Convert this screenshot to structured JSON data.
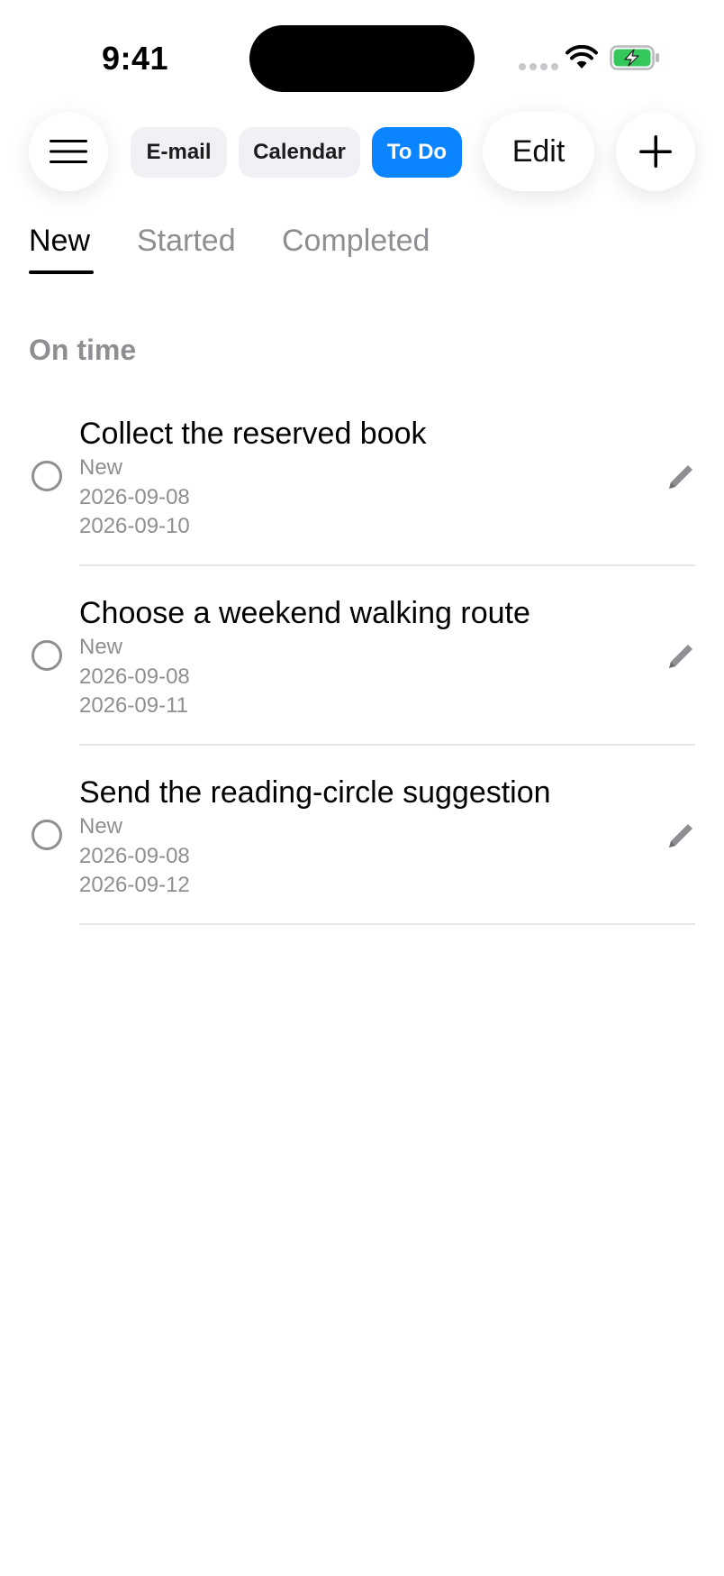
{
  "status_bar": {
    "time": "9:41"
  },
  "toolbar": {
    "email_label": "E-mail",
    "calendar_label": "Calendar",
    "todo_label": "To Do",
    "edit_label": "Edit"
  },
  "tabs": [
    {
      "label": "New",
      "active": true
    },
    {
      "label": "Started",
      "active": false
    },
    {
      "label": "Completed",
      "active": false
    }
  ],
  "section": {
    "title": "On time"
  },
  "tasks": [
    {
      "title": "Collect the reserved book",
      "status": "New",
      "start": "2026-09-08",
      "due": "2026-09-10"
    },
    {
      "title": "Choose a weekend walking route",
      "status": "New",
      "start": "2026-09-08",
      "due": "2026-09-11"
    },
    {
      "title": "Send the reading-circle suggestion",
      "status": "New",
      "start": "2026-09-08",
      "due": "2026-09-12"
    }
  ],
  "colors": {
    "accent": "#0a84ff",
    "secondary_text": "#8e8e93",
    "pill_background": "#f0f0f5",
    "battery_fill": "#34c759"
  }
}
